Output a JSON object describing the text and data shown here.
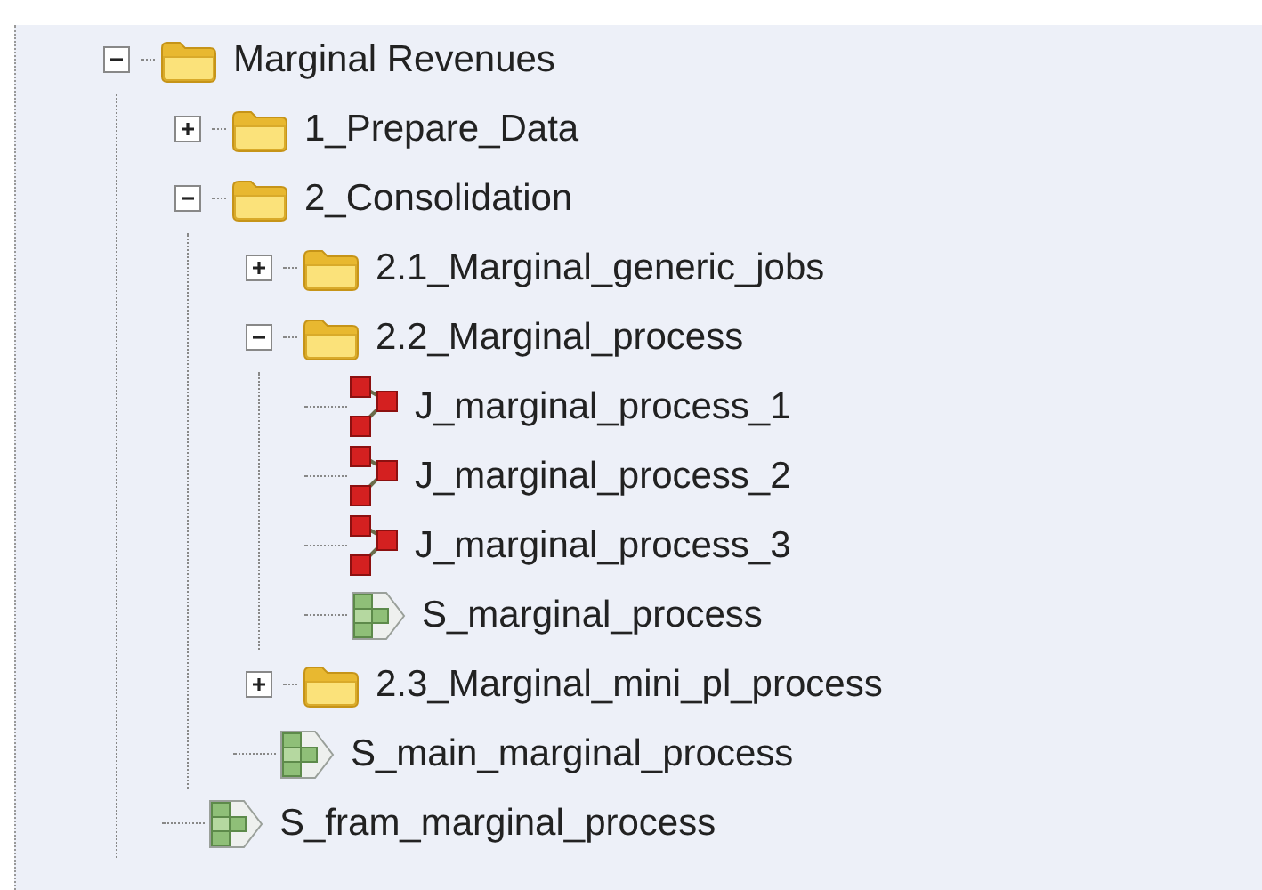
{
  "tree": [
    {
      "kind": "folder",
      "label": "Marginal Revenues",
      "expanded": true,
      "children": [
        {
          "kind": "folder",
          "label": "1_Prepare_Data",
          "expanded": false
        },
        {
          "kind": "folder",
          "label": "2_Consolidation",
          "expanded": true,
          "children": [
            {
              "kind": "folder",
              "label": "2.1_Marginal_generic_jobs",
              "expanded": false
            },
            {
              "kind": "folder",
              "label": "2.2_Marginal_process",
              "expanded": true,
              "children": [
                {
                  "kind": "job",
                  "label": "J_marginal_process_1"
                },
                {
                  "kind": "job",
                  "label": "J_marginal_process_2"
                },
                {
                  "kind": "job",
                  "label": "J_marginal_process_3"
                },
                {
                  "kind": "sequence",
                  "label": "S_marginal_process"
                }
              ]
            },
            {
              "kind": "folder",
              "label": "2.3_Marginal_mini_pl_process",
              "expanded": false
            },
            {
              "kind": "sequence",
              "label": "S_main_marginal_process"
            }
          ]
        },
        {
          "kind": "sequence",
          "label": "S_fram_marginal_process"
        }
      ]
    }
  ]
}
